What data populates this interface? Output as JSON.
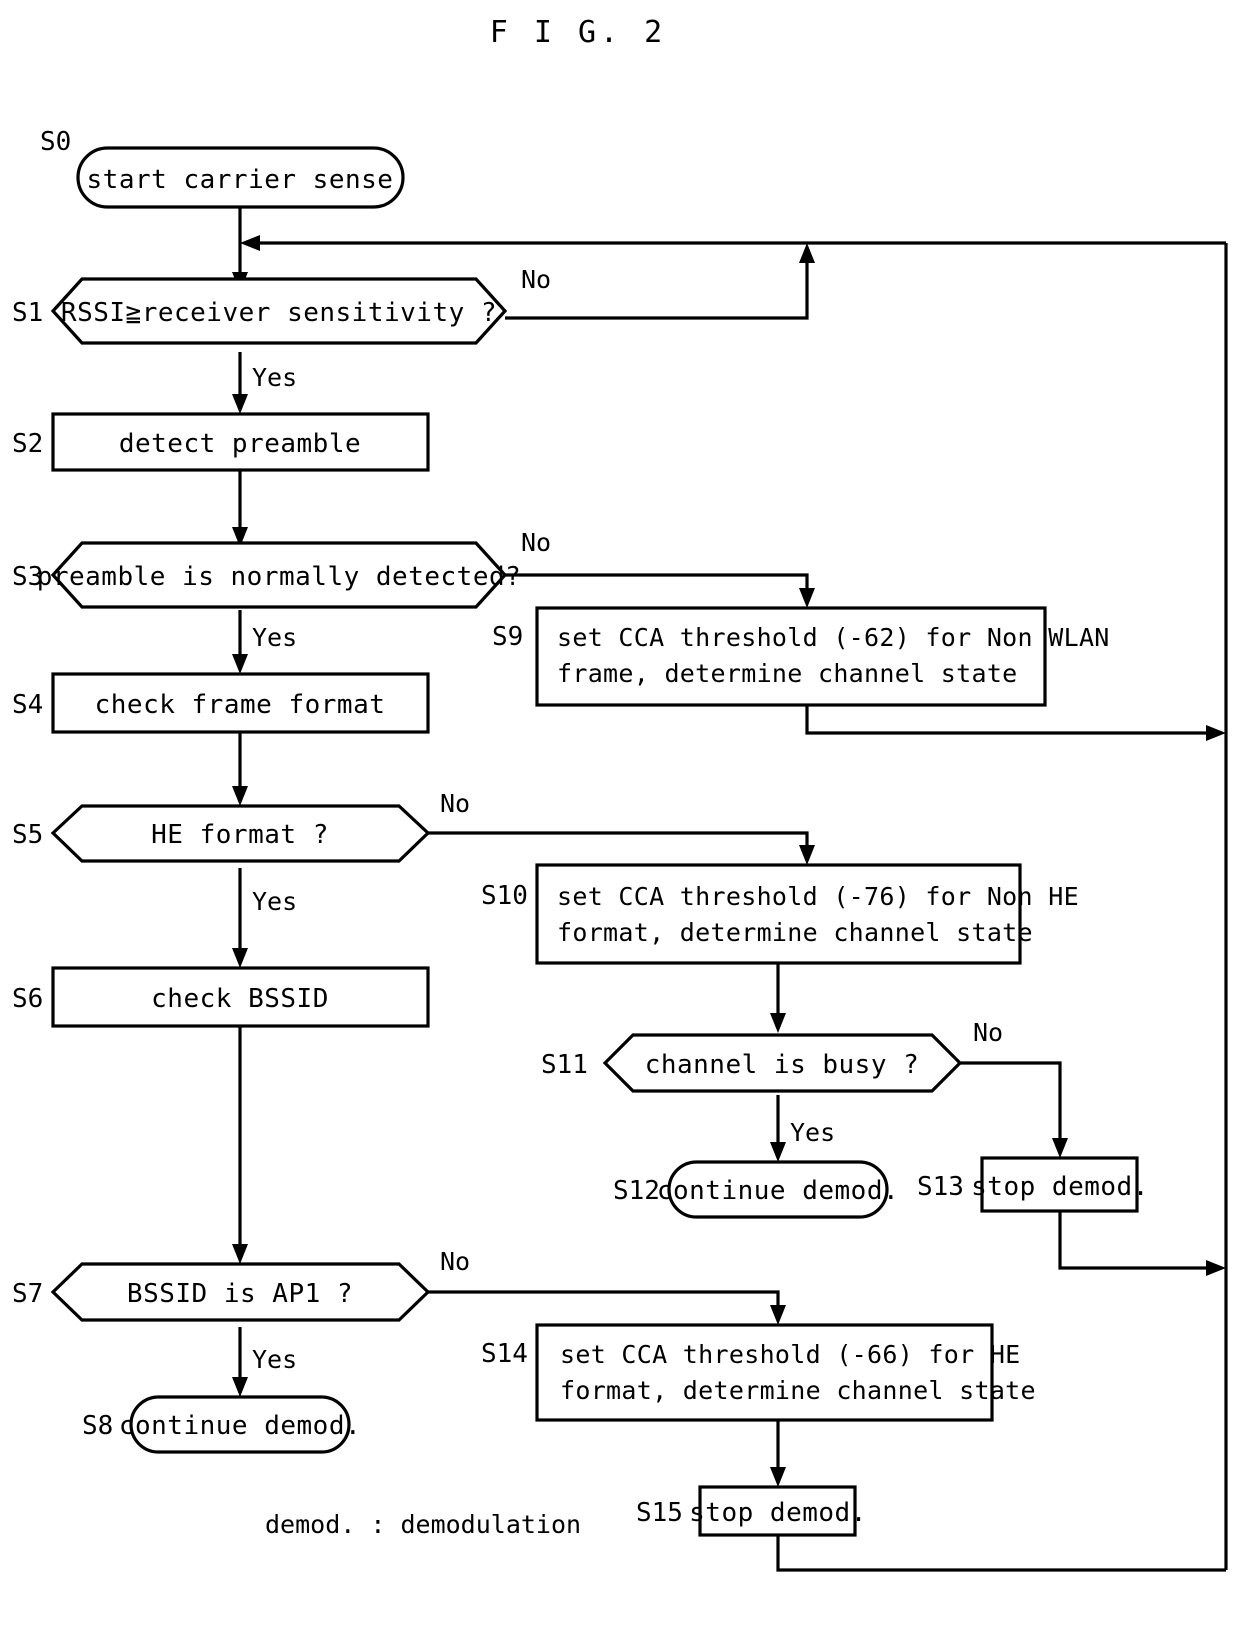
{
  "figure": {
    "title": "F I G. 2",
    "footnote": "demod. : demodulation"
  },
  "nodes": {
    "s0": {
      "step": "S0",
      "label": "start carrier sense",
      "shape": "rounded"
    },
    "s1": {
      "step": "S1",
      "label": "RSSI≧receiver sensitivity ?",
      "shape": "hexagon"
    },
    "s2": {
      "step": "S2",
      "label": "detect preamble",
      "shape": "rect"
    },
    "s3": {
      "step": "S3",
      "label": "preamble is normally detected?",
      "shape": "hexagon"
    },
    "s4": {
      "step": "S4",
      "label": "check frame format",
      "shape": "rect"
    },
    "s5": {
      "step": "S5",
      "label": "HE format ?",
      "shape": "hexagon"
    },
    "s6": {
      "step": "S6",
      "label": "check BSSID",
      "shape": "rect"
    },
    "s7": {
      "step": "S7",
      "label": "BSSID is AP1 ?",
      "shape": "hexagon"
    },
    "s8": {
      "step": "S8",
      "label": "continue demod.",
      "shape": "rounded"
    },
    "s9": {
      "step": "S9",
      "label_line1": "set CCA threshold (-62) for Non WLAN",
      "label_line2": "frame, determine channel state",
      "shape": "rect"
    },
    "s10": {
      "step": "S10",
      "label_line1": "set CCA threshold (-76) for Non HE",
      "label_line2": "format, determine channel state",
      "shape": "rect"
    },
    "s11": {
      "step": "S11",
      "label": "channel is busy ?",
      "shape": "hexagon"
    },
    "s12": {
      "step": "S12",
      "label": "continue demod.",
      "shape": "rounded"
    },
    "s13": {
      "step": "S13",
      "label": "stop demod.",
      "shape": "rect"
    },
    "s14": {
      "step": "S14",
      "label_line1": "set CCA threshold (-66) for HE",
      "label_line2": "format, determine channel state",
      "shape": "rect"
    },
    "s15": {
      "step": "S15",
      "label": "stop demod.",
      "shape": "rect"
    }
  },
  "branches": {
    "s1_no": "No",
    "s1_yes": "Yes",
    "s3_no": "No",
    "s3_yes": "Yes",
    "s5_no": "No",
    "s5_yes": "Yes",
    "s7_no": "No",
    "s7_yes": "Yes",
    "s11_no": "No",
    "s11_yes": "Yes"
  },
  "colors": {
    "stroke": "#000000",
    "fill": "#ffffff",
    "text": "#000000"
  }
}
